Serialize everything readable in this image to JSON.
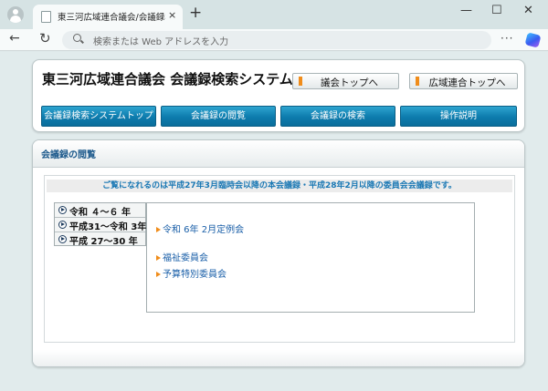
{
  "browser": {
    "tab_title": "東三河広域連合議会/会議録検索",
    "tab_close": "×",
    "new_tab": "+",
    "window_controls": {
      "minimize": "—",
      "maximize": "☐",
      "close": "✕"
    },
    "back": "←",
    "reload": "↻",
    "address_placeholder": "検索または Web アドレスを入力",
    "menu": "···"
  },
  "header": {
    "title": "東三河広域連合議会 会議録検索システム",
    "link_council_top": "議会トップへ",
    "link_union_top": "広域連合トップへ",
    "accent_color": "#f08c1a"
  },
  "nav": {
    "items": [
      "会議録検索システムトップ",
      "会議録の閲覧",
      "会議録の検索",
      "操作説明"
    ],
    "color": "#0d7bad"
  },
  "main": {
    "section_title": "会議録の閲覧",
    "notice": "ご覧になれるのは平成27年3月臨時会以降の本会議録・平成28年2月以降の委員会会議録です。",
    "eras": [
      "令和 ４～６ 年",
      "平成31～令和 3年",
      "平成 27～30 年"
    ],
    "meetings": [
      "令和 6年 2月定例会",
      "福祉委員会",
      "予算特別委員会"
    ]
  }
}
